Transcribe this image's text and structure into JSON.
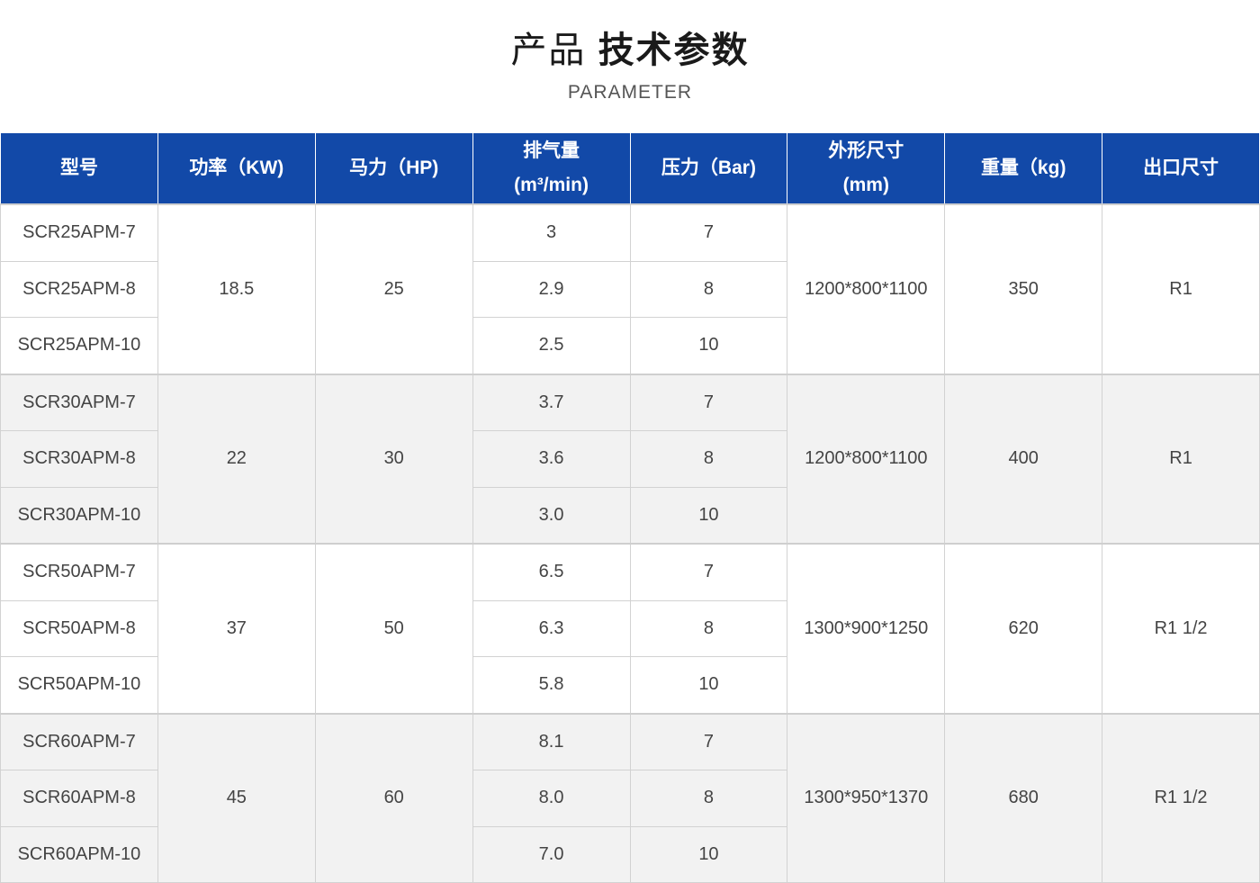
{
  "heading": {
    "title_light": "产品",
    "title_bold": "技术参数",
    "subtitle": "PARAMETER"
  },
  "colors": {
    "header_bg": "#1249a8",
    "header_text": "#ffffff",
    "alt_row_bg": "#f2f2f2"
  },
  "table": {
    "columns": [
      {
        "label": "型号"
      },
      {
        "label": "功率（KW)"
      },
      {
        "label": "马力（HP)"
      },
      {
        "label": "排气量",
        "label2": "(m³/min)"
      },
      {
        "label": "压力（Bar)"
      },
      {
        "label": "外形尺寸",
        "label2": "(mm)"
      },
      {
        "label": "重量（kg)"
      },
      {
        "label": "出口尺寸"
      }
    ],
    "groups": [
      {
        "power": "18.5",
        "hp": "25",
        "size": "1200*800*1100",
        "weight": "350",
        "outlet": "R1",
        "rows": [
          {
            "model": "SCR25APM-7",
            "flow": "3",
            "pressure": "7"
          },
          {
            "model": "SCR25APM-8",
            "flow": "2.9",
            "pressure": "8"
          },
          {
            "model": "SCR25APM-10",
            "flow": "2.5",
            "pressure": "10"
          }
        ]
      },
      {
        "power": "22",
        "hp": "30",
        "size": "1200*800*1100",
        "weight": "400",
        "outlet": "R1",
        "rows": [
          {
            "model": "SCR30APM-7",
            "flow": "3.7",
            "pressure": "7"
          },
          {
            "model": "SCR30APM-8",
            "flow": "3.6",
            "pressure": "8"
          },
          {
            "model": "SCR30APM-10",
            "flow": "3.0",
            "pressure": "10"
          }
        ]
      },
      {
        "power": "37",
        "hp": "50",
        "size": "1300*900*1250",
        "weight": "620",
        "outlet": "R1 1/2",
        "rows": [
          {
            "model": "SCR50APM-7",
            "flow": "6.5",
            "pressure": "7"
          },
          {
            "model": "SCR50APM-8",
            "flow": "6.3",
            "pressure": "8"
          },
          {
            "model": "SCR50APM-10",
            "flow": "5.8",
            "pressure": "10"
          }
        ]
      },
      {
        "power": "45",
        "hp": "60",
        "size": "1300*950*1370",
        "weight": "680",
        "outlet": "R1 1/2",
        "rows": [
          {
            "model": "SCR60APM-7",
            "flow": "8.1",
            "pressure": "7"
          },
          {
            "model": "SCR60APM-8",
            "flow": "8.0",
            "pressure": "8"
          },
          {
            "model": "SCR60APM-10",
            "flow": "7.0",
            "pressure": "10"
          }
        ]
      }
    ]
  }
}
